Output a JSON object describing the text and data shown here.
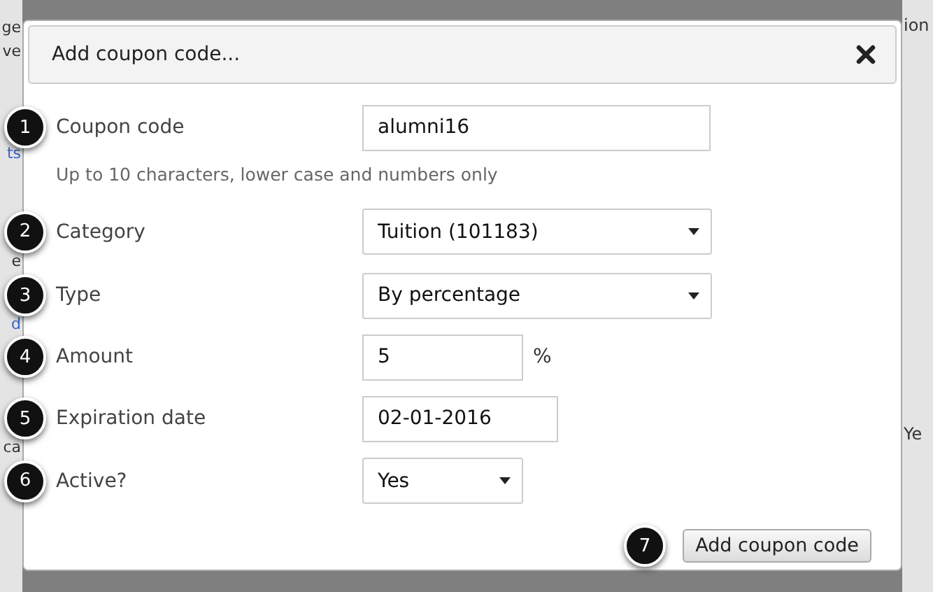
{
  "background": {
    "left_fragments": [
      {
        "text": "ge",
        "kind": "text"
      },
      {
        "text": "ve",
        "kind": "text"
      },
      {
        "text": "ts",
        "kind": "link"
      },
      {
        "text": "e",
        "kind": "text"
      },
      {
        "text": "d",
        "kind": "link"
      },
      {
        "text": "ca",
        "kind": "text"
      }
    ],
    "right_fragments": [
      {
        "text": "ion"
      },
      {
        "text": "Ye"
      }
    ]
  },
  "dialog": {
    "title": "Add coupon code...",
    "fields": [
      {
        "marker": "1",
        "label": "Coupon code",
        "kind": "text",
        "value": "alumni16",
        "hint": "Up to 10 characters, lower case and numbers only"
      },
      {
        "marker": "2",
        "label": "Category",
        "kind": "select",
        "value": "Tuition (101183)"
      },
      {
        "marker": "3",
        "label": "Type",
        "kind": "select",
        "value": "By percentage"
      },
      {
        "marker": "4",
        "label": "Amount",
        "kind": "text",
        "value": "5",
        "unit": "%"
      },
      {
        "marker": "5",
        "label": "Expiration date",
        "kind": "text",
        "value": "02-01-2016"
      },
      {
        "marker": "6",
        "label": "Active?",
        "kind": "select",
        "value": "Yes"
      }
    ],
    "submit": {
      "marker": "7",
      "label": "Add coupon code"
    }
  }
}
